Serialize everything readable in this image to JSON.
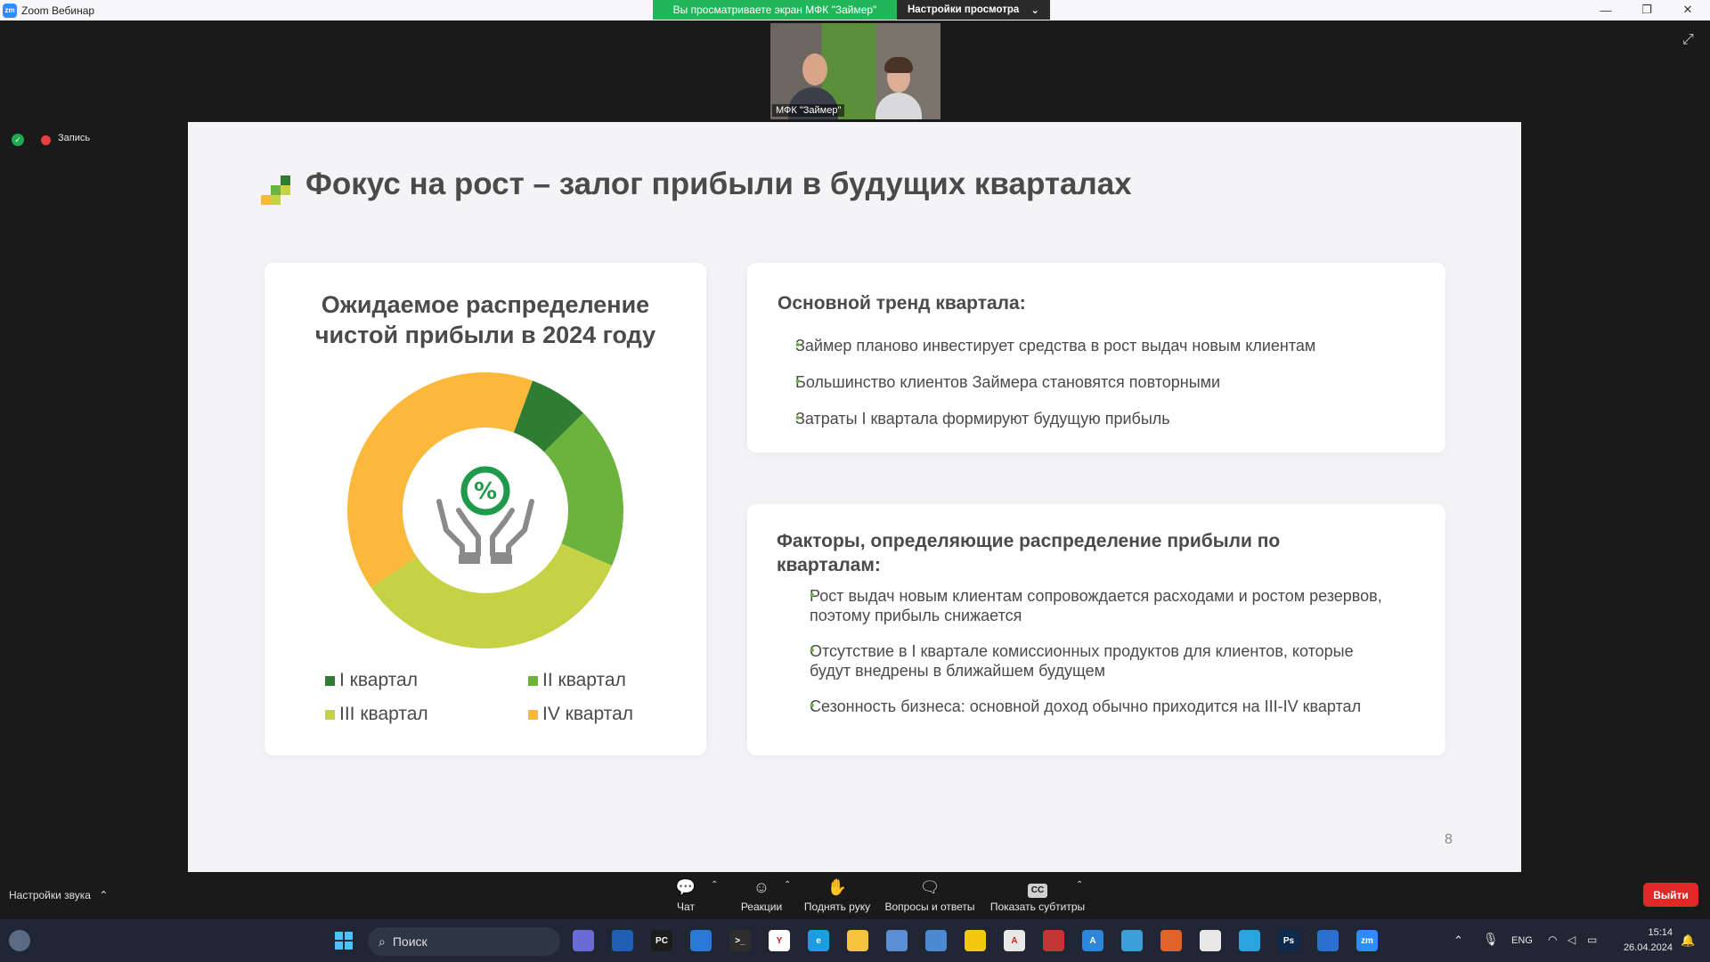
{
  "window": {
    "app_title": "Zoom Вебинар",
    "app_logo_text": "zm",
    "share_banner": "Вы просматриваете экран МФК \"Займер\"",
    "view_settings": "Настройки просмотра"
  },
  "video": {
    "name_tag": "МФК \"Займер\""
  },
  "status": {
    "recording_label": "Запись"
  },
  "slide": {
    "title": "Фокус на рост – залог прибыли в будущих кварталах",
    "page_number": "8",
    "left_card": {
      "title_line1": "Ожидаемое распределение",
      "title_line2": "чистой прибыли в 2024 году"
    },
    "trend": {
      "heading": "Основной тренд квартала:",
      "bullets": [
        "Займер планово инвестирует средства в рост выдач новым клиентам",
        "Большинство клиентов Займера становятся повторными",
        "Затраты I квартала формируют будущую прибыль"
      ]
    },
    "factors": {
      "heading_line1": "Факторы, определяющие распределение прибыли по",
      "heading_line2": "кварталам:",
      "bullets": [
        [
          "Рост выдач новым клиентам сопровождается расходами и ростом резервов,",
          "поэтому прибыль снижается"
        ],
        [
          "Отсутствие в I квартале комиссионных продуктов для клиентов, которые",
          "будут внедрены в ближайшем будущем"
        ],
        [
          "Сезонность бизнеса: основной доход обычно приходится на III-IV квартал"
        ]
      ]
    }
  },
  "chart_data": {
    "type": "pie",
    "variant": "donut",
    "title": "Ожидаемое распределение чистой прибыли в 2024 году",
    "categories": [
      "I квартал",
      "II квартал",
      "III квартал",
      "IV квартал"
    ],
    "values": [
      7,
      19,
      34,
      40
    ],
    "colors": [
      "#2e7d32",
      "#6cb33e",
      "#c7d145",
      "#fbb83b"
    ],
    "start_angle_deg": 20,
    "legend": "bottom",
    "center_icon": "hands-percent-icon"
  },
  "toolbar": {
    "audio_settings": "Настройки звука",
    "chat": "Чат",
    "reactions": "Реакции",
    "raise_hand": "Поднять руку",
    "qa": "Вопросы и ответы",
    "captions": "Показать субтитры",
    "captions_icon_text": "CC",
    "leave": "Выйти"
  },
  "taskbar": {
    "search_placeholder": "Поиск",
    "language": "ENG",
    "time": "15:14",
    "date": "26.04.2024",
    "app_icons": [
      {
        "name": "copilot-icon",
        "color": "#6b6bd8",
        "label": ""
      },
      {
        "name": "word-app-icon",
        "color": "#1f5fb8",
        "label": ""
      },
      {
        "name": "pycharm-icon",
        "color": "#1c1c1c",
        "label": "PC"
      },
      {
        "name": "outlook-icon",
        "color": "#2b79d6",
        "label": ""
      },
      {
        "name": "terminal-icon",
        "color": "#2d2d2d",
        "label": ">_"
      },
      {
        "name": "yandex-browser-icon",
        "color": "#ffffff",
        "label": "Y"
      },
      {
        "name": "edge-icon",
        "color": "#1b9de2",
        "label": "e"
      },
      {
        "name": "explorer-icon",
        "color": "#f4c23c",
        "label": ""
      },
      {
        "name": "control-panel-icon",
        "color": "#5a8fd6",
        "label": ""
      },
      {
        "name": "monitor-icon",
        "color": "#4b8ad0",
        "label": ""
      },
      {
        "name": "power-bi-icon",
        "color": "#f2c811",
        "label": ""
      },
      {
        "name": "chart-app-icon",
        "color": "#e8e8e8",
        "label": "A"
      },
      {
        "name": "game-icon",
        "color": "#c23535",
        "label": ""
      },
      {
        "name": "azure-icon",
        "color": "#2c86d9",
        "label": "A"
      },
      {
        "name": "stock-app-icon",
        "color": "#3c9fd8",
        "label": ""
      },
      {
        "name": "matlab-icon",
        "color": "#e0632c",
        "label": ""
      },
      {
        "name": "slack-icon",
        "color": "#e8e8e8",
        "label": ""
      },
      {
        "name": "telegram-icon",
        "color": "#2aa3df",
        "label": ""
      },
      {
        "name": "photoshop-icon",
        "color": "#0b2a4c",
        "label": "Ps"
      },
      {
        "name": "defender-icon",
        "color": "#2b6fd0",
        "label": ""
      },
      {
        "name": "zoom-taskbar-icon",
        "color": "#2d8cff",
        "label": "zm"
      }
    ]
  }
}
